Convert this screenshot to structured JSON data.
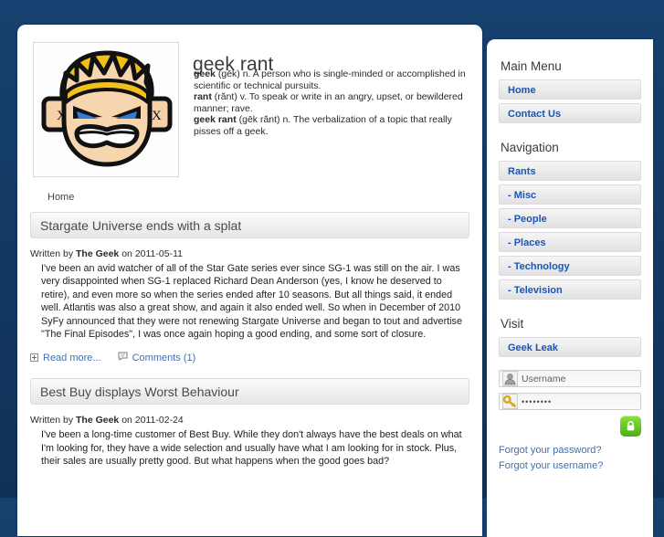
{
  "site": {
    "title": "geek rant",
    "logo_alt": "angry-geek-face-logo"
  },
  "definitions": [
    {
      "term": "geek",
      "rest": " (gēk) n. A person who is single-minded or accomplished in scientific or technical pursuits."
    },
    {
      "term": "rant",
      "rest": " (rănt) v. To speak or write in an angry, upset, or bewildered manner; rave."
    },
    {
      "term": "geek rant",
      "rest": " (gēk rănt) n. The verbalization of a topic that really pisses off a geek."
    }
  ],
  "breadcrumb": "Home",
  "articles": [
    {
      "title": "Stargate Universe ends with a splat",
      "written_by_label": "Written by",
      "author": "The Geek",
      "on_label": "on",
      "date": "2011-05-11",
      "body": "I've been an avid watcher of all of the Star Gate series ever since SG-1 was still on the air.  I was very disappointed when SG-1 replaced Richard Dean Anderson (yes, I know he deserved to retire), and even more so when the series ended after 10 seasons.  But all things said, it ended well.  Atlantis was also a great show, and again it also ended well.  So when in December of 2010 SyFy announced that they were not renewing Stargate Universe and began to tout and advertise \"The Final Episodes\", I was once again hoping a good ending, and some sort of closure.",
      "read_more": "Read more...",
      "comments": "Comments (1)"
    },
    {
      "title": "Best Buy displays Worst Behaviour",
      "written_by_label": "Written by",
      "author": "The Geek",
      "on_label": "on",
      "date": "2011-02-24",
      "body": "I've been a long-time customer of Best Buy.  While they don't always have the best deals on what I'm looking for, they have a wide selection and usually have what I am looking for in stock.  Plus, their sales are usually pretty good.  But what happens when the good goes bad?"
    }
  ],
  "sidebar": {
    "main_menu": {
      "heading": "Main Menu",
      "items": [
        {
          "label": "Home"
        },
        {
          "label": "Contact Us"
        }
      ]
    },
    "navigation": {
      "heading": "Navigation",
      "items": [
        {
          "label": "Rants"
        },
        {
          "label": "- Misc"
        },
        {
          "label": "- People"
        },
        {
          "label": "- Places"
        },
        {
          "label": "- Technology"
        },
        {
          "label": "- Television"
        }
      ]
    },
    "visit": {
      "heading": "Visit",
      "items": [
        {
          "label": "Geek Leak"
        }
      ]
    },
    "login": {
      "username_placeholder": "Username",
      "password_value": "••••••••",
      "submit_label": "Log in",
      "forgot_password": "Forgot your password?",
      "forgot_username": "Forgot your username?"
    }
  },
  "colors": {
    "page_background": "#133a66",
    "link": "#3f6fb5",
    "menu_link": "#1b55b3",
    "login_button": "#62c81f"
  }
}
